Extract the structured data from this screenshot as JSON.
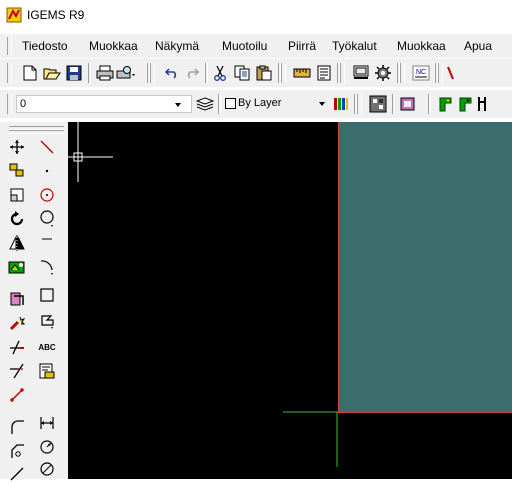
{
  "window": {
    "title": "IGEMS R9"
  },
  "menu": {
    "items": [
      "Tiedosto",
      "Muokkaa",
      "Näkymä",
      "Muotoilu",
      "Piirrä",
      "Työkalut",
      "Muokkaa",
      "Apua"
    ]
  },
  "properties": {
    "layer": "0",
    "linetype": "By Layer"
  },
  "toolbar": {
    "nc_label": "NC"
  },
  "left_toolbar": {
    "text_tool_label": "ABC"
  },
  "colors": {
    "canvas": "#000000",
    "sheet": "#3a6d6c",
    "sheet_border": "#d04040",
    "axis_green": "#2ec12e",
    "toolbar_bg": "#f0f0f0"
  }
}
